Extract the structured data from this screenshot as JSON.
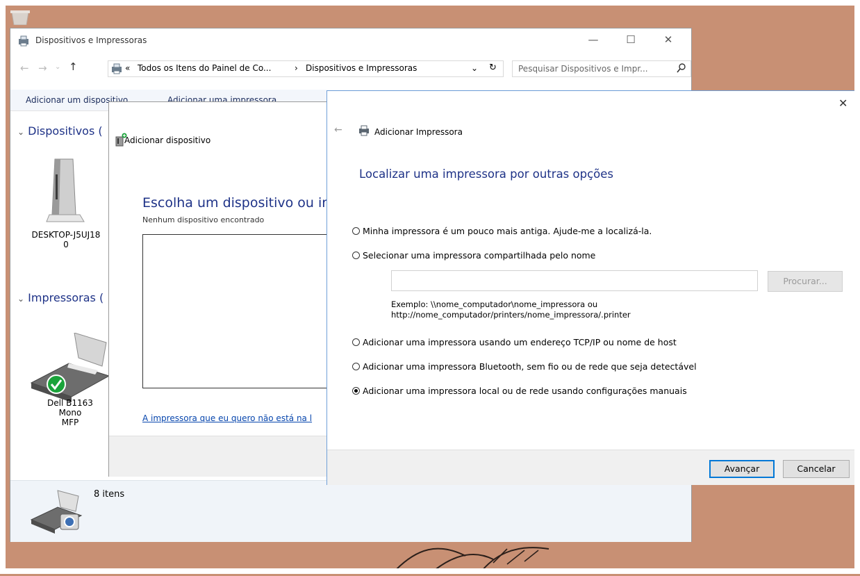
{
  "main_window": {
    "title": "Dispositivos e Impressoras",
    "breadcrumb_prefix": "«",
    "breadcrumb_parent": "Todos os Itens do Painel de Co...",
    "breadcrumb_sep": "›",
    "breadcrumb_current": "Dispositivos e Impressoras",
    "search_placeholder": "Pesquisar Dispositivos e Impr...",
    "toolbar": {
      "add_device": "Adicionar um dispositivo",
      "add_printer": "Adicionar uma impressora"
    },
    "devices_header": "Dispositivos (",
    "printers_header": "Impressoras (",
    "devices": [
      {
        "label_line1": "DESKTOP-J5UJ18",
        "label_line2": "0"
      }
    ],
    "printers": [
      {
        "label_line1": "Dell B1163 Mono",
        "label_line2": "MFP"
      }
    ],
    "status_count": "8 itens"
  },
  "add_device_dialog": {
    "title": "Adicionar dispositivo",
    "heading": "Escolha um dispositivo ou ir",
    "subtext": "Nenhum dispositivo encontrado",
    "link": "A impressora que eu quero não está na l"
  },
  "add_printer_dialog": {
    "title": "Adicionar Impressora",
    "close_glyph": "✕",
    "heading": "Localizar uma impressora por outras opções",
    "options": [
      {
        "label": "Minha impressora é um pouco mais antiga. Ajude-me a localizá-la.",
        "selected": false
      },
      {
        "label": "Selecionar uma impressora compartilhada pelo nome",
        "selected": false
      },
      {
        "label": "Adicionar uma impressora usando um endereço TCP/IP ou nome de host",
        "selected": false
      },
      {
        "label": "Adicionar uma impressora Bluetooth, sem fio ou de rede que seja detectável",
        "selected": false
      },
      {
        "label": "Adicionar uma impressora local ou de rede usando configurações manuais",
        "selected": true
      }
    ],
    "share_name_value": "",
    "browse_button": "Procurar...",
    "example_line1": "Exemplo: \\\\nome_computador\\nome_impressora ou",
    "example_line2": "http://nome_computador/printers/nome_impressora/.printer",
    "next_button": "Avançar",
    "cancel_button": "Cancelar"
  },
  "colors": {
    "desktop_bg": "#c89074",
    "heading_blue": "#1e3287",
    "accent_border": "#0078d7"
  }
}
